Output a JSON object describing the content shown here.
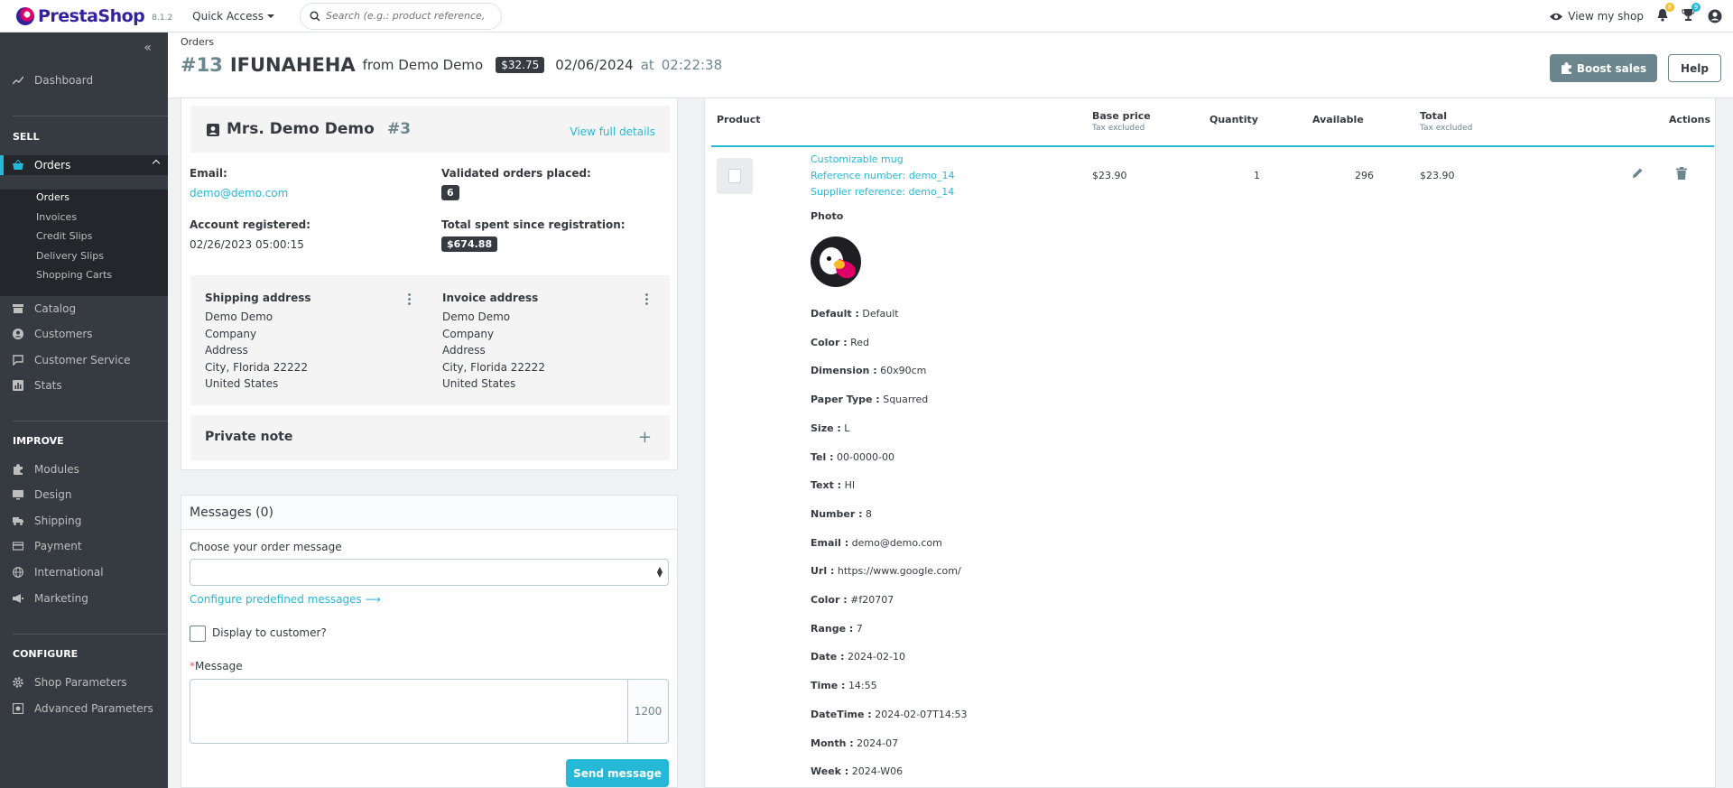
{
  "header": {
    "logo_text": "PrestaShop",
    "version": "8.1.2",
    "quick_access": "Quick Access",
    "search_placeholder": "Search (e.g.: product reference, custon",
    "view_shop": "View my shop",
    "notif_count_1": "8",
    "notif_count_2": "9"
  },
  "sidebar": {
    "dashboard": "Dashboard",
    "sell": "SELL",
    "orders": "Orders",
    "sub": [
      "Orders",
      "Invoices",
      "Credit Slips",
      "Delivery Slips",
      "Shopping Carts"
    ],
    "catalog": "Catalog",
    "customers": "Customers",
    "customer_service": "Customer Service",
    "stats": "Stats",
    "improve": "IMPROVE",
    "modules": "Modules",
    "design": "Design",
    "shipping": "Shipping",
    "payment": "Payment",
    "international": "International",
    "marketing": "Marketing",
    "configure": "CONFIGURE",
    "shop_parameters": "Shop Parameters",
    "advanced_parameters": "Advanced Parameters"
  },
  "page": {
    "breadcrumb": "Orders",
    "order_num": "#13",
    "order_ref": "IFUNAHEHA",
    "from": "from Demo Demo",
    "amount": "$32.75",
    "date": "02/06/2024",
    "at": "at",
    "time": "02:22:38",
    "boost": "Boost sales",
    "help": "Help"
  },
  "customer": {
    "name": "Mrs. Demo Demo",
    "id": "#3",
    "view_details": "View full details",
    "email_label": "Email:",
    "email": "demo@demo.com",
    "validated_label": "Validated orders placed:",
    "validated": "6",
    "registered_label": "Account registered:",
    "registered": "02/26/2023 05:00:15",
    "spent_label": "Total spent since registration:",
    "spent": "$674.88",
    "shipping_title": "Shipping address",
    "shipping_lines": [
      "Demo Demo",
      "Company",
      "Address",
      "City, Florida 22222",
      "United States"
    ],
    "invoice_title": "Invoice address",
    "invoice_lines": [
      "Demo Demo",
      "Company",
      "Address",
      "City, Florida 22222",
      "United States"
    ],
    "private_note": "Private note"
  },
  "messages": {
    "title": "Messages (0)",
    "choose": "Choose your order message",
    "configure": "Configure predefined messages",
    "display": "Display to customer?",
    "message_req": "*",
    "message": "Message",
    "counter": "1200",
    "send": "Send message"
  },
  "products": {
    "headers": {
      "product": "Product",
      "base_price": "Base price",
      "base_price_sub": "Tax excluded",
      "quantity": "Quantity",
      "available": "Available",
      "total": "Total",
      "total_sub": "Tax excluded",
      "actions": "Actions"
    },
    "name": "Customizable mug",
    "reference": "Reference number: demo_14",
    "supplier": "Supplier reference: demo_14",
    "price": "$23.90",
    "quantity": "1",
    "available": "296",
    "total": "$23.90",
    "photo_label": "Photo",
    "attributes": [
      {
        "k": "Default :",
        "v": "Default"
      },
      {
        "k": "Color :",
        "v": "Red"
      },
      {
        "k": "Dimension :",
        "v": "60x90cm"
      },
      {
        "k": "Paper Type :",
        "v": "Squarred"
      },
      {
        "k": "Size :",
        "v": "L"
      },
      {
        "k": "Tel :",
        "v": "00-0000-00"
      },
      {
        "k": "Text :",
        "v": "HI"
      },
      {
        "k": "Number :",
        "v": "8"
      },
      {
        "k": "Email :",
        "v": "demo@demo.com"
      },
      {
        "k": "Url :",
        "v": "https://www.google.com/"
      },
      {
        "k": "Color :",
        "v": "#f20707"
      },
      {
        "k": "Range :",
        "v": "7"
      },
      {
        "k": "Date :",
        "v": "2024-02-10"
      },
      {
        "k": "Time :",
        "v": "14:55"
      },
      {
        "k": "DateTime :",
        "v": "2024-02-07T14:53"
      },
      {
        "k": "Month :",
        "v": "2024-07"
      },
      {
        "k": "Week :",
        "v": "2024-W06"
      }
    ]
  }
}
